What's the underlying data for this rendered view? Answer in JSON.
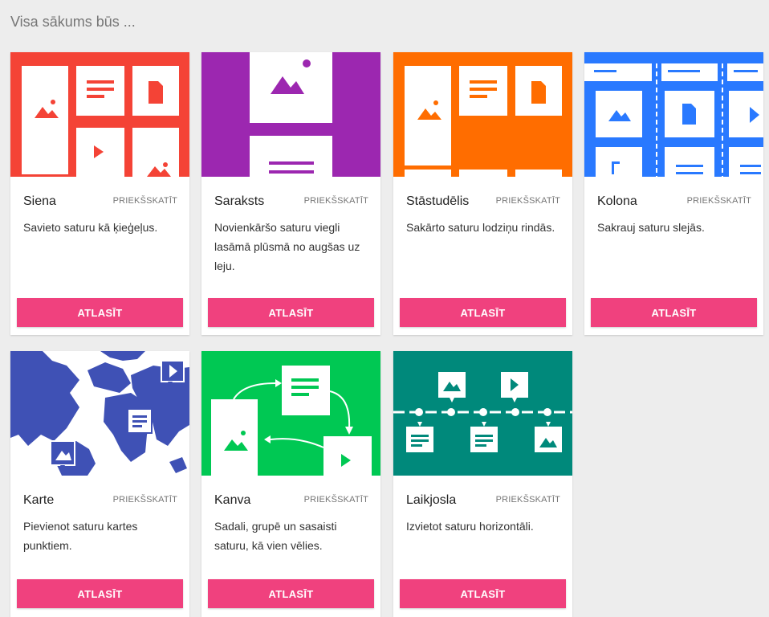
{
  "heading": "Visa sākums būs ...",
  "colors": {
    "accent": "#f0417e",
    "siena": "#f44336",
    "saraksts": "#9c27b0",
    "stastudelis": "#ff6d00",
    "kolona": "#2979ff",
    "karte": "#3f51b5",
    "kanva": "#00c853",
    "laikjosla": "#00897b"
  },
  "cards": [
    {
      "title": "Siena",
      "preview": "PRIEKŠSKATĪT",
      "description": "Savieto saturu kā ķieģeļus.",
      "button": "ATLASĪT",
      "thumbnail_icon": "wall-layout-icon"
    },
    {
      "title": "Saraksts",
      "preview": "PRIEKŠSKATĪT",
      "description": "Novienkāršo saturu viegli lasāmā plūsmā no augšas uz leju.",
      "button": "ATLASĪT",
      "thumbnail_icon": "stream-layout-icon"
    },
    {
      "title": "Stāstudēlis",
      "preview": "PRIEKŠSKATĪT",
      "description": "Sakārto saturu lodziņu rindās.",
      "button": "ATLASĪT",
      "thumbnail_icon": "grid-layout-icon"
    },
    {
      "title": "Kolona",
      "preview": "PRIEKŠSKATĪT",
      "description": "Sakrauj saturu slejās.",
      "button": "ATLASĪT",
      "thumbnail_icon": "columns-layout-icon"
    },
    {
      "title": "Karte",
      "preview": "PRIEKŠSKATĪT",
      "description": "Pievienot saturu kartes punktiem.",
      "button": "ATLASĪT",
      "thumbnail_icon": "map-layout-icon"
    },
    {
      "title": "Kanva",
      "preview": "PRIEKŠSKATĪT",
      "description": "Sadali, grupē un sasaisti saturu, kā vien vēlies.",
      "button": "ATLASĪT",
      "thumbnail_icon": "canvas-layout-icon"
    },
    {
      "title": "Laikjosla",
      "preview": "PRIEKŠSKATĪT",
      "description": "Izvietot saturu horizontāli.",
      "button": "ATLASĪT",
      "thumbnail_icon": "timeline-layout-icon"
    }
  ]
}
